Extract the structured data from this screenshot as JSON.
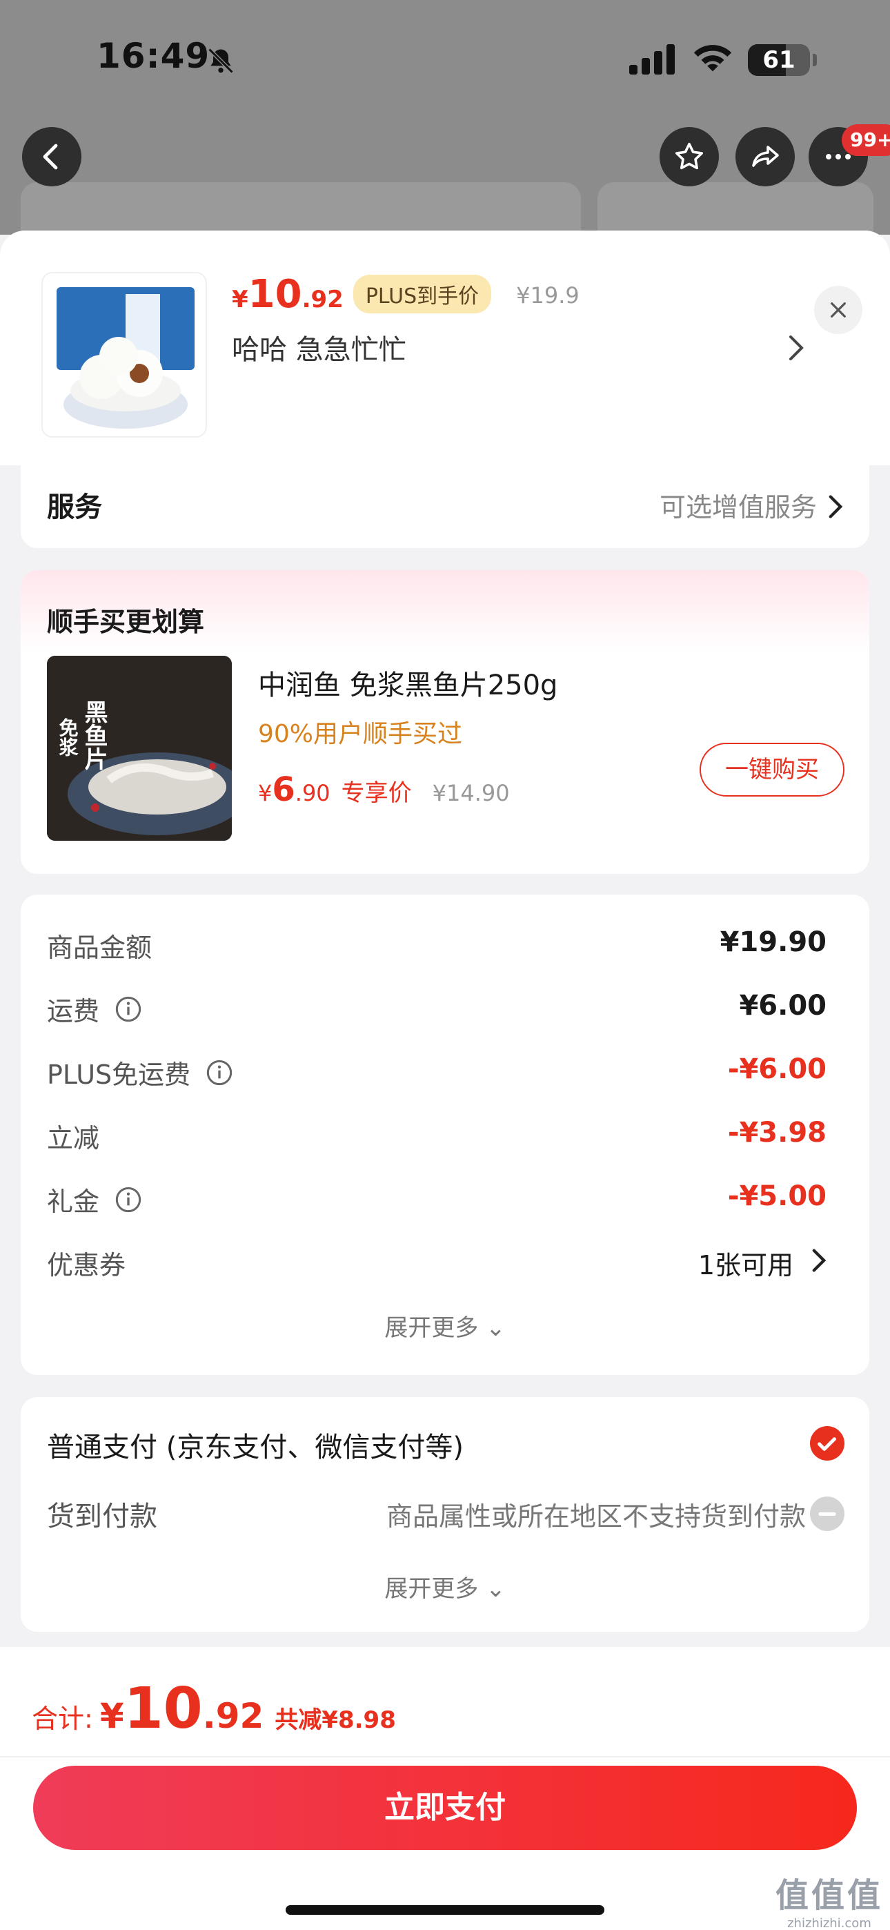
{
  "status_bar": {
    "time": "16:49",
    "battery": "61",
    "battery_level": 0.61
  },
  "nav": {
    "badge": "99+"
  },
  "product": {
    "price_symbol": "¥",
    "price_int": "10",
    "price_dec": ".92",
    "plus_tag": "PLUS到手价",
    "original_price": "¥19.9",
    "spec": "哈哈  急急忙忙"
  },
  "service": {
    "title": "服务",
    "value": "可选增值服务"
  },
  "bundle": {
    "title": "顺手买更划算",
    "name": "中润鱼 免浆黑鱼片250g",
    "subtitle": "90%用户顺手买过",
    "price_symbol": "¥",
    "price_int": "6",
    "price_dec": ".90",
    "price_label": "专享价",
    "original_price": "¥14.90",
    "button": "一键购买",
    "image_text": "黑鱼片",
    "image_text2": "免浆"
  },
  "summary": {
    "rows": [
      {
        "label": "商品金额",
        "value": "¥19.90"
      },
      {
        "label": "运费",
        "value": "¥6.00"
      },
      {
        "label": "PLUS免运费",
        "value": "-¥6.00"
      },
      {
        "label": "立减",
        "value": "-¥3.98"
      },
      {
        "label": "礼金",
        "value": "-¥5.00"
      },
      {
        "label": "优惠券",
        "value": "1张可用"
      }
    ],
    "expand": "展开更多 ⌄"
  },
  "payment": {
    "normal": "普通支付 (京东支付、微信支付等)",
    "cod": "货到付款",
    "cod_note": "商品属性或所在地区不支持货到付款",
    "expand": "展开更多 ⌄"
  },
  "footer": {
    "total_label": "合计:",
    "total_symbol": "¥",
    "total_int": "10",
    "total_dec": ".92",
    "total_save": "共减¥8.98",
    "pay_button": "立即支付"
  },
  "watermark": {
    "main": "值值值",
    "sub": "zhizhizhi.com"
  },
  "colors": {
    "accent": "#e8301f",
    "plus_tag_bg": "#fbe7b0",
    "coupon_orange": "#d7821e"
  }
}
